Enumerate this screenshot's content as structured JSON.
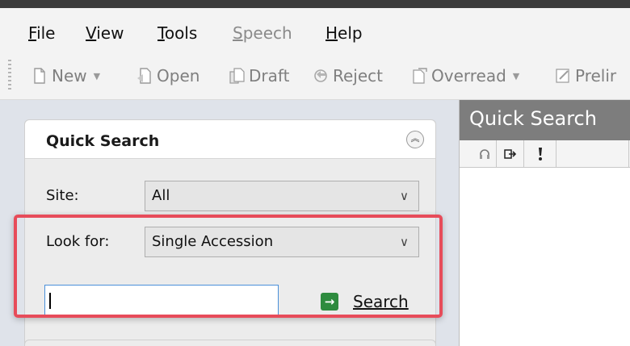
{
  "menu": {
    "items": [
      {
        "label": "File",
        "accel": "F",
        "rest": "ile",
        "enabled": true
      },
      {
        "label": "View",
        "accel": "V",
        "rest": "iew",
        "enabled": true
      },
      {
        "label": "Tools",
        "accel": "T",
        "rest": "ools",
        "enabled": true
      },
      {
        "label": "Speech",
        "accel": "S",
        "rest": "peech",
        "enabled": false
      },
      {
        "label": "Help",
        "accel": "H",
        "rest": "elp",
        "enabled": true
      }
    ]
  },
  "toolbar": {
    "new_label": "New",
    "open_label": "Open",
    "draft_label": "Draft",
    "reject_label": "Reject",
    "overread_label": "Overread",
    "prelim_label": "Prelir",
    "dropdown_caret": "▼"
  },
  "quick_search": {
    "title": "Quick Search",
    "collapse_glyph": "︽",
    "site_label": "Site:",
    "site_value": "All",
    "look_for_label": "Look for:",
    "look_for_value": "Single Accession",
    "search_value": "",
    "search_label": "Search",
    "search_icon": "→",
    "chevron": "∨"
  },
  "results": {
    "title": "Quick Search",
    "columns": [
      "headset-icon",
      "arrow-exit-icon",
      "exclamation-icon",
      ""
    ]
  },
  "colors": {
    "highlight": "#e74c5a",
    "accent_input": "#4a90d9",
    "search_icon_bg": "#2e8b3e",
    "results_header": "#7d7d7d"
  }
}
